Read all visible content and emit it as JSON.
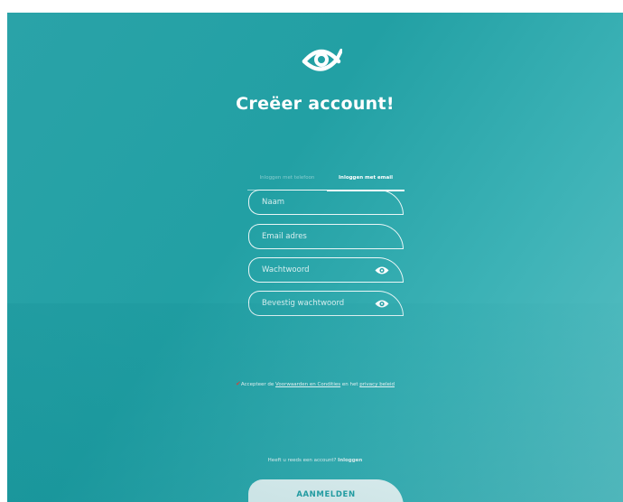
{
  "header": {
    "logo_icon": "eye-logo-icon",
    "title": "Creëer account!"
  },
  "tabs": [
    {
      "label": "Inloggen met telefoon",
      "active": false
    },
    {
      "label": "Inloggen met email",
      "active": true
    }
  ],
  "form": {
    "name_placeholder": "Naam",
    "email_placeholder": "Email adres",
    "password_placeholder": "Wachtwoord",
    "confirm_placeholder": "Bevestig wachtwoord",
    "password_toggle_icon": "eye-icon"
  },
  "terms": {
    "checked": true,
    "check_glyph": "✔",
    "prefix": "Accepteer de ",
    "terms_link": "Voorwaarden en Condities",
    "middle": " en het ",
    "privacy_link": "privacy beleid"
  },
  "footer": {
    "question": "Heeft u reeds een account? ",
    "login_link": "Inloggen",
    "submit_label": "AANMELDEN"
  },
  "colors": {
    "primary": "#2aa3a8",
    "text_on_primary": "#ffffff",
    "checkmark": "#e0443a"
  }
}
